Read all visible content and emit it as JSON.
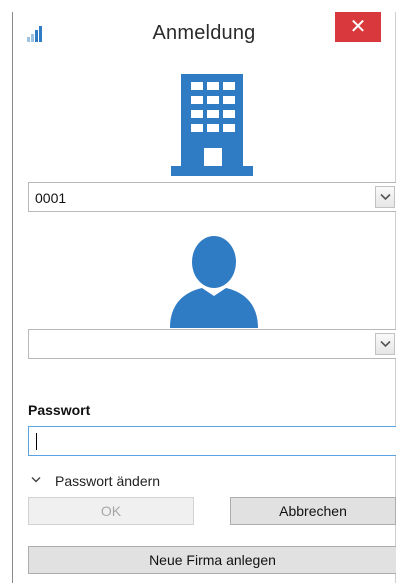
{
  "window": {
    "title": "Anmeldung",
    "close_glyph": "✕",
    "app_icon": "signal-bars-icon"
  },
  "company": {
    "icon": "building-icon",
    "selected_value": "0001"
  },
  "user": {
    "icon": "person-icon",
    "selected_value": ""
  },
  "password": {
    "label": "Passwort",
    "value": ""
  },
  "change_password": {
    "label": "Passwort ändern",
    "expanded": false
  },
  "buttons": {
    "ok": "OK",
    "cancel": "Abbrechen",
    "new_company": "Neue Firma anlegen"
  },
  "colors": {
    "accent": "#2f7cc4",
    "close": "#d9393c",
    "focus_border": "#5aa3e0"
  }
}
